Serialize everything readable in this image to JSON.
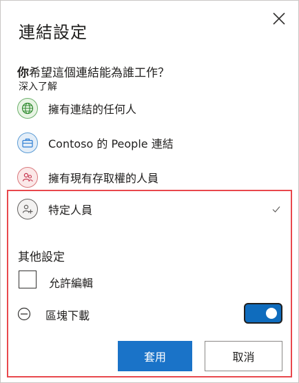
{
  "dialog": {
    "title": "連結設定",
    "close_icon": "close-icon"
  },
  "question": {
    "bold": "你",
    "rest": "希望這個連結能為誰工作？"
  },
  "learn_more": "深入了解",
  "options": [
    {
      "label": "擁有連結的任何人",
      "icon": "globe-icon",
      "color": "#2f8a2f"
    },
    {
      "label": "Contoso 的 People 連結",
      "icon": "briefcase-icon",
      "color": "#2b7cd3"
    },
    {
      "label": "擁有現有存取權的人員",
      "icon": "people-icon",
      "color": "#c4314b"
    },
    {
      "label": "特定人員",
      "icon": "add-people-icon",
      "color": "#605e5c",
      "selected": true
    }
  ],
  "other_settings": {
    "heading": "其他設定",
    "allow_edit": {
      "label": "允許編輯",
      "checked": false
    },
    "block_download": {
      "label": "區塊下載",
      "enabled": true
    }
  },
  "buttons": {
    "apply": "套用",
    "cancel": "取消"
  },
  "colors": {
    "accent": "#1a73c8",
    "highlight": "#e8474c"
  }
}
